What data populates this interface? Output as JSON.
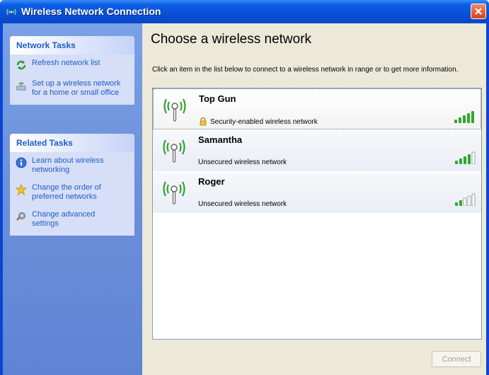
{
  "window": {
    "title": "Wireless Network Connection"
  },
  "sidebar": {
    "network_tasks": {
      "heading": "Network Tasks",
      "items": [
        {
          "label": "Refresh network list",
          "icon": "refresh-icon"
        },
        {
          "label": "Set up a wireless network\nfor a home or small office",
          "icon": "setup-network-icon"
        }
      ]
    },
    "related_tasks": {
      "heading": "Related Tasks",
      "items": [
        {
          "label": "Learn about wireless\nnetworking",
          "icon": "info-icon"
        },
        {
          "label": "Change the order of\npreferred networks",
          "icon": "star-icon"
        },
        {
          "label": "Change advanced\nsettings",
          "icon": "settings-icon"
        }
      ]
    }
  },
  "main": {
    "title": "Choose a wireless network",
    "instructions": "Click an item in the list below to connect to a wireless network in range or to get more information.",
    "networks": [
      {
        "name": "Top Gun",
        "status": "Security-enabled wireless network",
        "secured": true,
        "signal_bars": 5,
        "selected": true
      },
      {
        "name": "Samantha",
        "status": "Unsecured wireless network",
        "secured": false,
        "signal_bars": 4,
        "selected": false
      },
      {
        "name": "Roger",
        "status": "Unsecured wireless network",
        "secured": false,
        "signal_bars": 2,
        "selected": false
      }
    ],
    "connect_label": "Connect"
  },
  "colors": {
    "titlebar": "#0a4fd6",
    "sidebar": "#6b8fd9",
    "link": "#215dc6",
    "signal_green": "#2ea82e"
  }
}
